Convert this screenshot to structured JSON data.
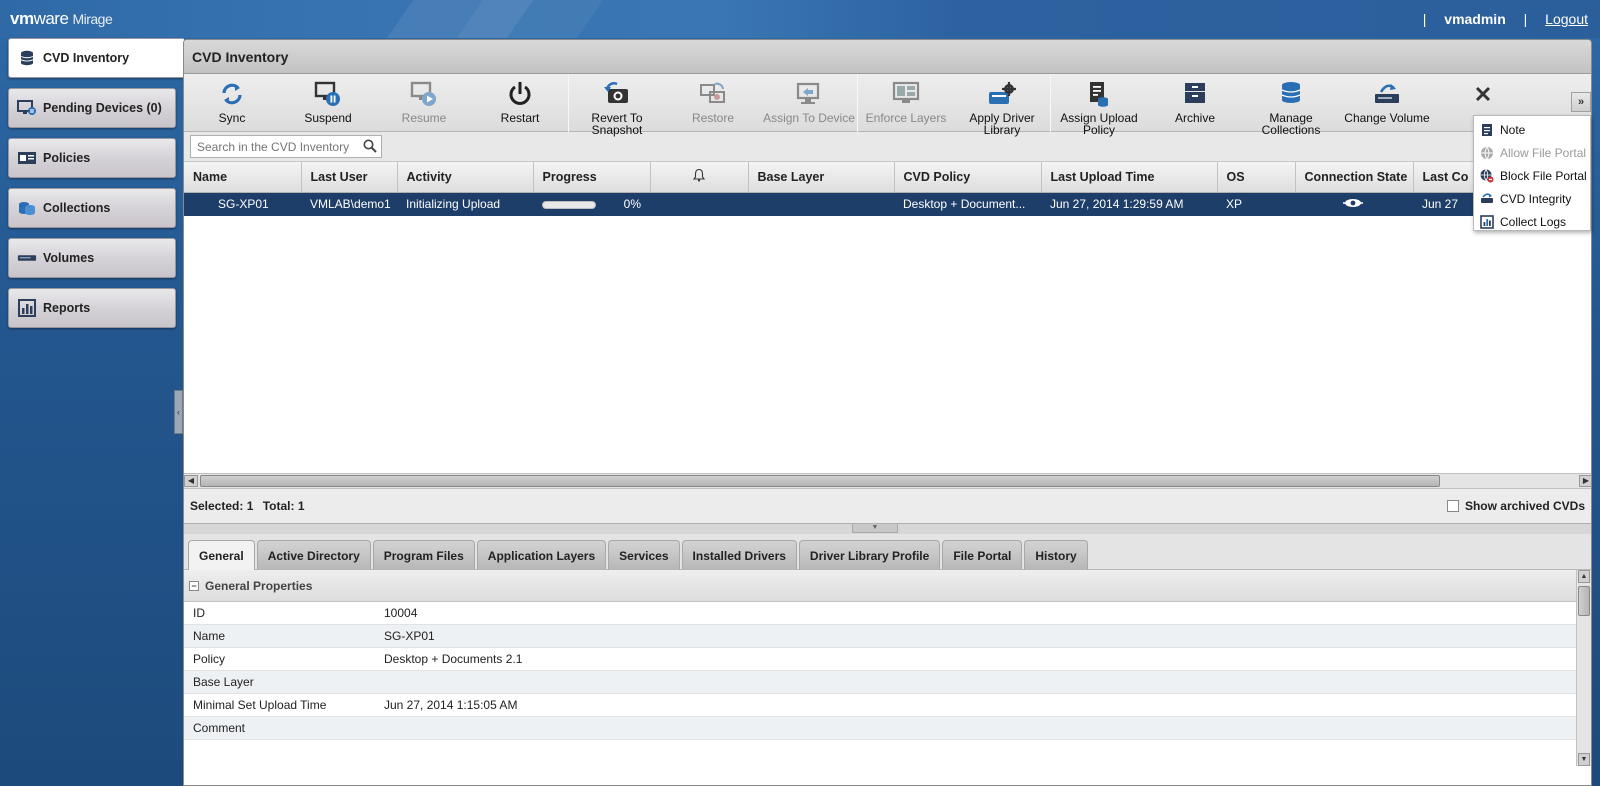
{
  "app": {
    "brand_vm": "vm",
    "brand_ware": "ware",
    "product": "Mirage",
    "username": "vmadmin",
    "separator": "|",
    "logout": "Logout"
  },
  "sidebar": {
    "items": [
      {
        "label": "CVD Inventory",
        "icon": "database-icon",
        "active": true
      },
      {
        "label": "Pending Devices (0)",
        "icon": "monitor-pending-icon",
        "active": false
      },
      {
        "label": "Policies",
        "icon": "policy-icon",
        "active": false
      },
      {
        "label": "Collections",
        "icon": "collections-icon",
        "active": false
      },
      {
        "label": "Volumes",
        "icon": "volume-icon",
        "active": false
      },
      {
        "label": "Reports",
        "icon": "report-icon",
        "active": false
      }
    ]
  },
  "main": {
    "title": "CVD Inventory"
  },
  "toolbar": {
    "buttons": [
      {
        "label": "Sync",
        "icon": "sync-icon",
        "enabled": true
      },
      {
        "label": "Suspend",
        "icon": "suspend-icon",
        "enabled": true
      },
      {
        "label": "Resume",
        "icon": "resume-icon",
        "enabled": false
      },
      {
        "label": "Restart",
        "icon": "power-icon",
        "enabled": true
      },
      {
        "label": "Revert To Snapshot",
        "icon": "revert-snapshot-icon",
        "enabled": true
      },
      {
        "label": "Restore",
        "icon": "restore-icon",
        "enabled": false
      },
      {
        "label": "Assign To Device",
        "icon": "assign-device-icon",
        "enabled": false
      },
      {
        "label": "Enforce Layers",
        "icon": "enforce-layers-icon",
        "enabled": false
      },
      {
        "label": "Apply Driver Library",
        "icon": "driver-library-icon",
        "enabled": true
      },
      {
        "label": "Assign Upload Policy",
        "icon": "upload-policy-icon",
        "enabled": true
      },
      {
        "label": "Archive",
        "icon": "archive-icon",
        "enabled": true
      },
      {
        "label": "Manage Collections",
        "icon": "manage-collections-icon",
        "enabled": true
      },
      {
        "label": "Change Volume",
        "icon": "change-volume-icon",
        "enabled": true
      },
      {
        "label": "",
        "icon": "close-icon",
        "enabled": true
      }
    ],
    "more_glyph": "»"
  },
  "search": {
    "placeholder": "Search in the CVD Inventory"
  },
  "grid": {
    "columns": [
      "Name",
      "Last User",
      "Activity",
      "Progress",
      "",
      "Base Layer",
      "CVD Policy",
      "Last Upload Time",
      "OS",
      "Connection State",
      "Last Co"
    ],
    "rows": [
      {
        "name": "SG-XP01",
        "last_user": "VMLAB\\demo1",
        "activity": "Initializing Upload",
        "progress": 0,
        "progress_text": "0%",
        "alert": "",
        "base_layer": "",
        "cvd_policy": "Desktop + Document...",
        "last_upload": "Jun 27, 2014 1:29:59 AM",
        "os": "XP",
        "connection": "connected-icon",
        "last_co": "Jun 27"
      }
    ]
  },
  "more_menu": {
    "items": [
      {
        "label": "Note",
        "icon": "note-icon",
        "enabled": true
      },
      {
        "label": "Allow File Portal",
        "icon": "allow-portal-icon",
        "enabled": false
      },
      {
        "label": "Block File Portal",
        "icon": "block-portal-icon",
        "enabled": true
      },
      {
        "label": "CVD Integrity",
        "icon": "integrity-icon",
        "enabled": true
      },
      {
        "label": "Collect Logs",
        "icon": "collect-logs-icon",
        "enabled": true
      }
    ]
  },
  "status": {
    "selected": "Selected: 1",
    "total": "Total: 1",
    "show_archived": "Show archived CVDs"
  },
  "tabs": [
    "General",
    "Active Directory",
    "Program Files",
    "Application Layers",
    "Services",
    "Installed Drivers",
    "Driver Library Profile",
    "File Portal",
    "History"
  ],
  "properties": {
    "section_title": "General Properties",
    "rows": [
      {
        "key": "ID",
        "value": "10004"
      },
      {
        "key": "Name",
        "value": "SG-XP01"
      },
      {
        "key": "Policy",
        "value": "Desktop + Documents 2.1"
      },
      {
        "key": "Base Layer",
        "value": ""
      },
      {
        "key": "Minimal Set Upload Time",
        "value": "Jun 27, 2014 1:15:05 AM"
      },
      {
        "key": "Comment",
        "value": ""
      }
    ]
  },
  "colors": {
    "accent": "#2f6aa7",
    "selected_row": "#1e3e6a",
    "icon_blue": "#2a6fb4"
  }
}
